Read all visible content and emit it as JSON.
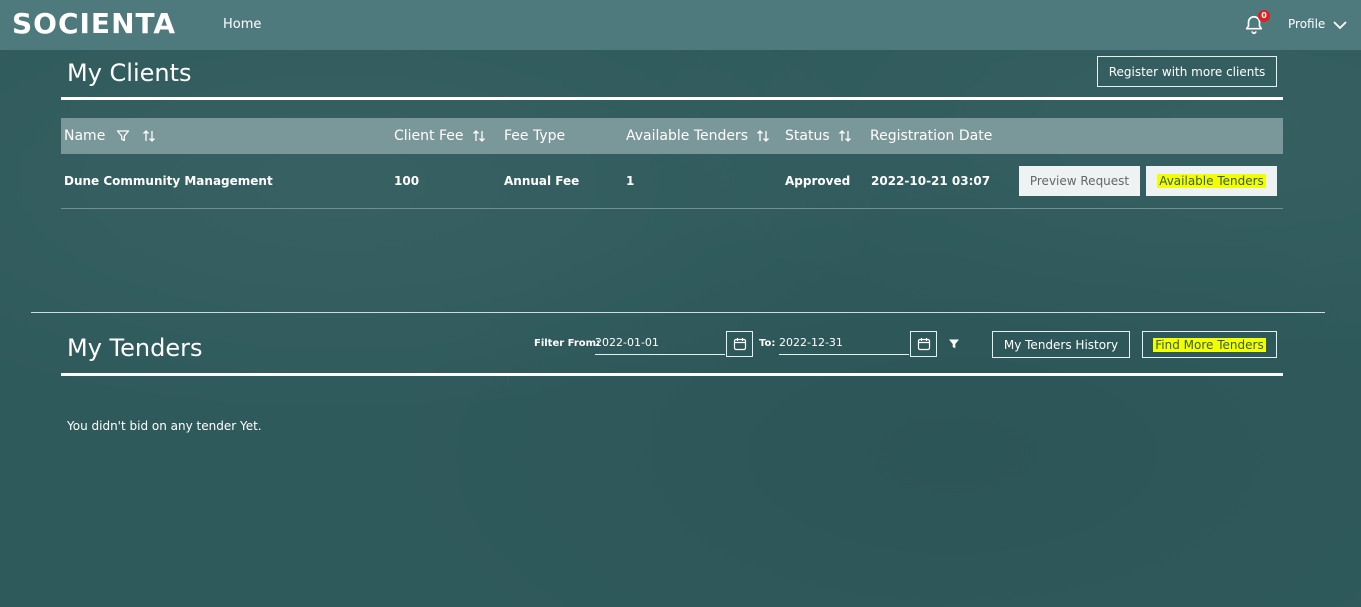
{
  "header": {
    "logo": "SOCIENTA",
    "nav_home": "Home",
    "notifications_count": "0",
    "profile_label": "Profile"
  },
  "clients": {
    "title": "My Clients",
    "register_button": "Register with more clients",
    "columns": [
      "Name",
      "Client Fee",
      "Fee Type",
      "Available Tenders",
      "Status",
      "Registration Date"
    ],
    "rows": [
      {
        "name": "Dune Community Management",
        "client_fee": "100",
        "fee_type": "Annual Fee",
        "available_tenders": "1",
        "status": "Approved",
        "registration_date": "2022-10-21 03:07",
        "preview_button": "Preview Request",
        "tenders_button": "Available Tenders"
      }
    ]
  },
  "tenders": {
    "title": "My Tenders",
    "filter_from_label": "Filter From:",
    "filter_from_value": "2022-01-01",
    "filter_to_label": "To:",
    "filter_to_value": "2022-12-31",
    "history_button": "My Tenders History",
    "find_button": "Find More Tenders",
    "empty_message": "You didn't bid on any tender Yet."
  },
  "colors": {
    "background": "#2f5a5c",
    "topbar": "#4f7a7d",
    "table_header": "#7a9799",
    "highlight": "#f2ff00",
    "badge": "#e0201e"
  }
}
